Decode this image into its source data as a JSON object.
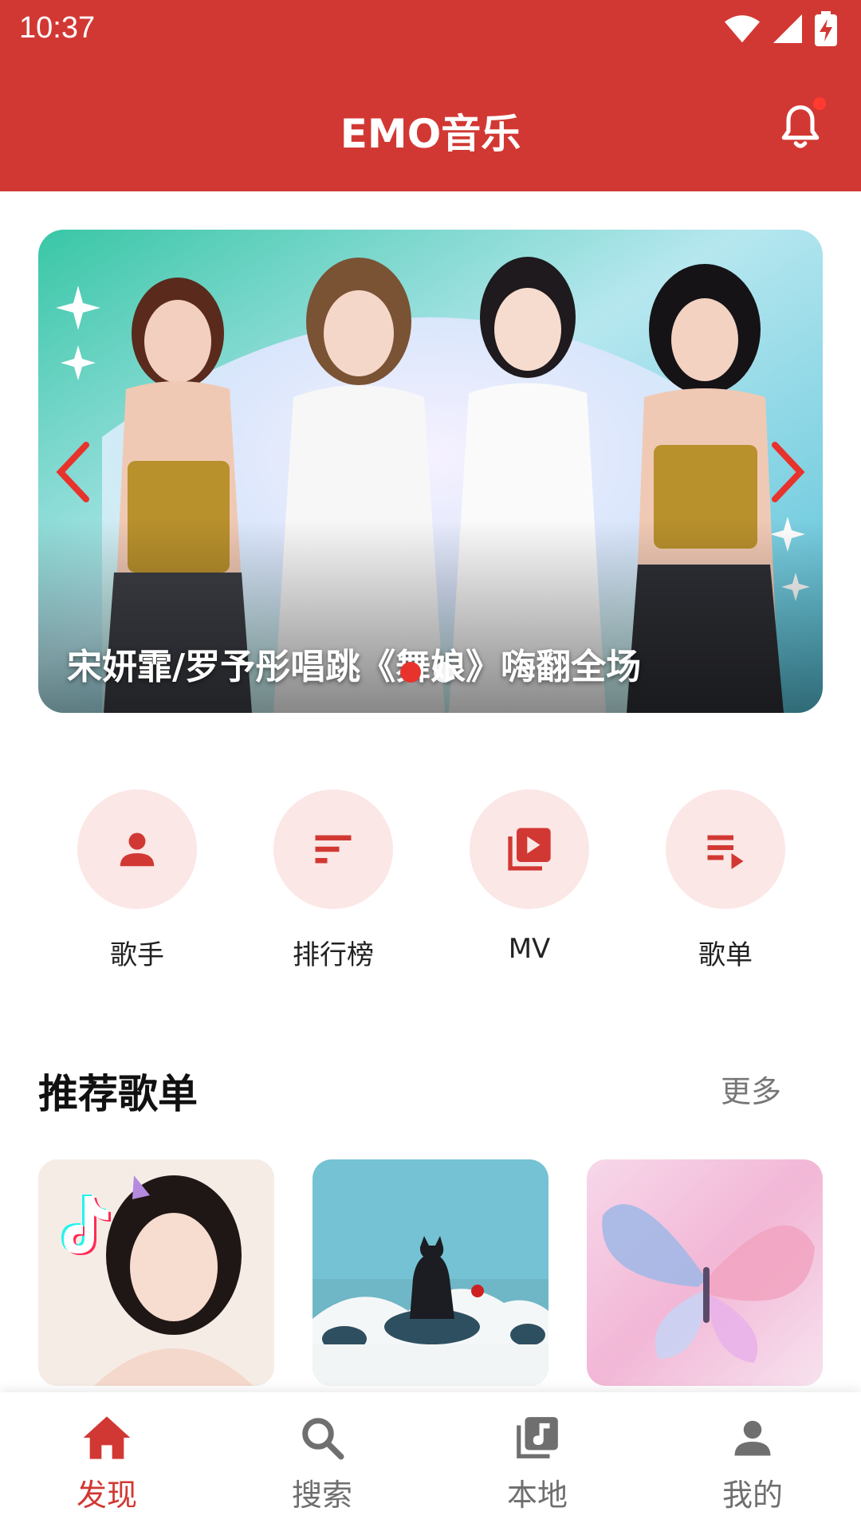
{
  "status_bar": {
    "time": "10:37"
  },
  "app_bar": {
    "title": "EMO音乐"
  },
  "banner": {
    "caption": "宋妍霏/罗予彤唱跳《舞娘》嗨翻全场",
    "slide_count": 2,
    "active_slide": 0
  },
  "quick_menu": [
    {
      "label": "歌手",
      "icon": "person-icon"
    },
    {
      "label": "排行榜",
      "icon": "sort-icon"
    },
    {
      "label": "MV",
      "icon": "video-library-icon"
    },
    {
      "label": "歌单",
      "icon": "playlist-play-icon"
    }
  ],
  "recommended": {
    "title": "推荐歌单",
    "more_label": "更多"
  },
  "bottom_nav": [
    {
      "label": "发现",
      "icon": "home-icon",
      "active": true
    },
    {
      "label": "搜索",
      "icon": "search-icon",
      "active": false
    },
    {
      "label": "本地",
      "icon": "library-music-icon",
      "active": false
    },
    {
      "label": "我的",
      "icon": "person-icon",
      "active": false
    }
  ],
  "colors": {
    "primary": "#d23833",
    "accent_bg": "#fbe7e6",
    "inactive": "#6f6f6f"
  }
}
